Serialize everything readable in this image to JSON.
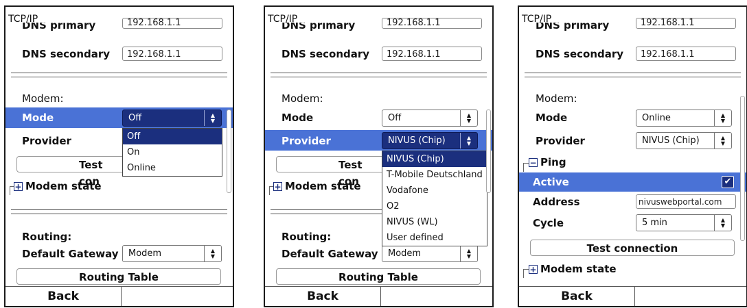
{
  "common": {
    "title": "TCP/IP",
    "dns_primary_label": "DNS primary",
    "dns_primary_value": "192.168.1.1",
    "dns_secondary_label": "DNS secondary",
    "dns_secondary_value": "192.168.1.1",
    "modem_section": "Modem:",
    "mode_label": "Mode",
    "provider_label": "Provider",
    "modem_state_label": "Modem state",
    "routing_section": "Routing:",
    "default_gateway_label": "Default Gateway",
    "default_gateway_value": "Modem",
    "routing_table_button": "Routing Table",
    "back_button": "Back"
  },
  "screen1": {
    "mode_value": "Off",
    "test_button_partial": "Test con",
    "mode_options": [
      "Off",
      "On",
      "Online"
    ]
  },
  "screen2": {
    "mode_value": "Off",
    "provider_value": "NIVUS (Chip)",
    "test_button_partial": "Test con",
    "provider_options": [
      "NIVUS (Chip)",
      "T-Mobile Deutschland",
      "Vodafone",
      "O2",
      "NIVUS (WL)",
      "User defined"
    ]
  },
  "screen3": {
    "mode_value": "Online",
    "provider_value": "NIVUS (Chip)",
    "ping_label": "Ping",
    "active_label": "Active",
    "active_checked": true,
    "address_label": "Address",
    "address_value": "nivuswebportal.com",
    "cycle_label": "Cycle",
    "cycle_value": "5 min",
    "test_button": "Test connection"
  },
  "colors": {
    "highlight": "#4a72d6",
    "selected": "#1b2f7e"
  }
}
